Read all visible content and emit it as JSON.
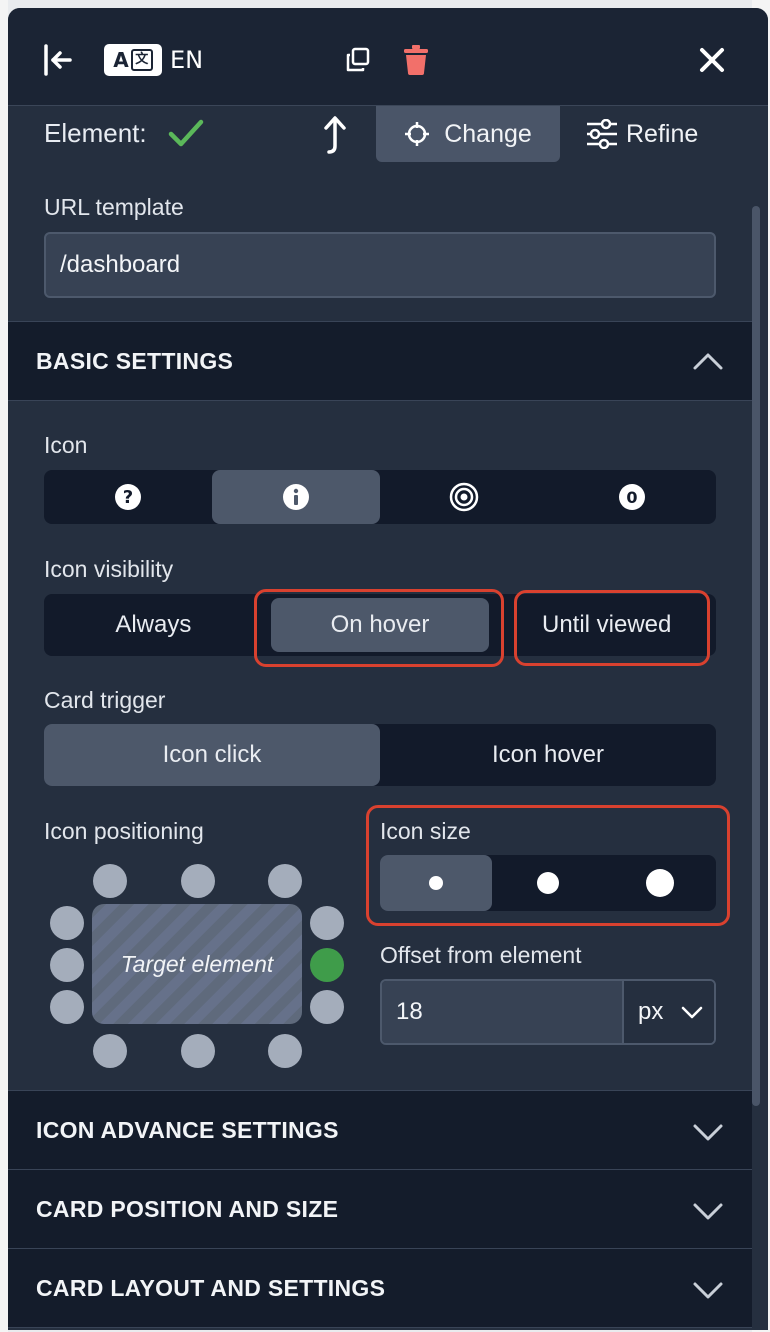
{
  "header": {
    "language": "EN",
    "icons": {
      "collapse": "collapse-left-icon",
      "translate": "translate-icon",
      "duplicate": "duplicate-icon",
      "delete": "trash-icon",
      "close": "close-icon"
    },
    "delete_color": "#f2706a"
  },
  "element": {
    "label": "Element:",
    "change_label": "Change",
    "refine_label": "Refine",
    "check_color": "#5bb85a"
  },
  "url_template": {
    "label": "URL template",
    "value": "/dashboard"
  },
  "basic_settings": {
    "title": "BASIC SETTINGS",
    "icon": {
      "label": "Icon",
      "options": [
        {
          "icon": "question-icon",
          "glyph": "?"
        },
        {
          "icon": "info-icon",
          "glyph": "i"
        },
        {
          "icon": "target-icon",
          "glyph": ""
        },
        {
          "icon": "zero-icon",
          "glyph": "0"
        }
      ],
      "selected_index": 1
    },
    "icon_visibility": {
      "label": "Icon visibility",
      "options": [
        "Always",
        "On hover",
        "Until viewed"
      ],
      "selected_index": 1
    },
    "card_trigger": {
      "label": "Card trigger",
      "options": [
        "Icon click",
        "Icon hover"
      ],
      "selected_index": 0
    },
    "icon_positioning": {
      "label": "Icon positioning",
      "target_label": "Target element",
      "selected": "right-middle",
      "selected_color": "#3f9c4a"
    },
    "icon_size": {
      "label": "Icon size",
      "options": [
        "small",
        "medium",
        "large"
      ],
      "selected_index": 0
    },
    "offset": {
      "label": "Offset from element",
      "value": "18",
      "unit": "px"
    }
  },
  "sections": [
    {
      "title": "ICON ADVANCE SETTINGS"
    },
    {
      "title": "CARD POSITION AND SIZE"
    },
    {
      "title": "CARD LAYOUT AND SETTINGS"
    }
  ],
  "highlight_color": "#d9412f"
}
